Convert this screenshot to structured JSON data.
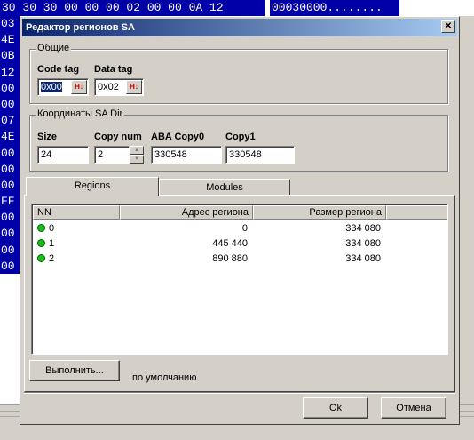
{
  "hex_editor": {
    "top_bytes": "30 30 30 00 00 00 02 00 00 0A 12",
    "top_ascii": "00030000........",
    "left_column": [
      "03",
      "4E",
      "0B",
      "12",
      "00",
      "00",
      "07",
      "4E",
      "00",
      "00",
      "00",
      "FF",
      "00",
      "00",
      "00",
      "00"
    ]
  },
  "dialog": {
    "title": "Редактор регионов SA",
    "close_glyph": "✕",
    "general_group": {
      "legend": "Общие",
      "code_tag_label": "Code tag",
      "code_tag_value": "0x00",
      "data_tag_label": "Data tag",
      "data_tag_value": "0x02",
      "hex_button_label": "H↓"
    },
    "coords_group": {
      "legend": "Координаты SA Dir",
      "size_label": "Size",
      "size_value": "24",
      "copy_num_label": "Copy num",
      "copy_num_value": "2",
      "aba_copy0_label": "ABA Copy0",
      "aba_copy0_value": "330548",
      "copy1_label": "Copy1",
      "copy1_value": "330548"
    },
    "tabs": [
      {
        "label": "Regions",
        "active": true
      },
      {
        "label": "Modules",
        "active": false
      }
    ],
    "regions_list": {
      "columns": [
        "NN",
        "Адрес региона",
        "Размер региона"
      ],
      "rows": [
        {
          "nn": "0",
          "address": "0",
          "size": "334 080"
        },
        {
          "nn": "1",
          "address": "445 440",
          "size": "334 080"
        },
        {
          "nn": "2",
          "address": "890 880",
          "size": "334 080"
        }
      ]
    },
    "execute_button": "Выполнить...",
    "default_label": "по умолчанию",
    "ok_button": "Ok",
    "cancel_button": "Отмена"
  },
  "colors": {
    "hex_highlight": "#0000a8",
    "title_gradient_start": "#0a246a",
    "title_gradient_end": "#a6caf0",
    "status_dot": "#18c018"
  }
}
